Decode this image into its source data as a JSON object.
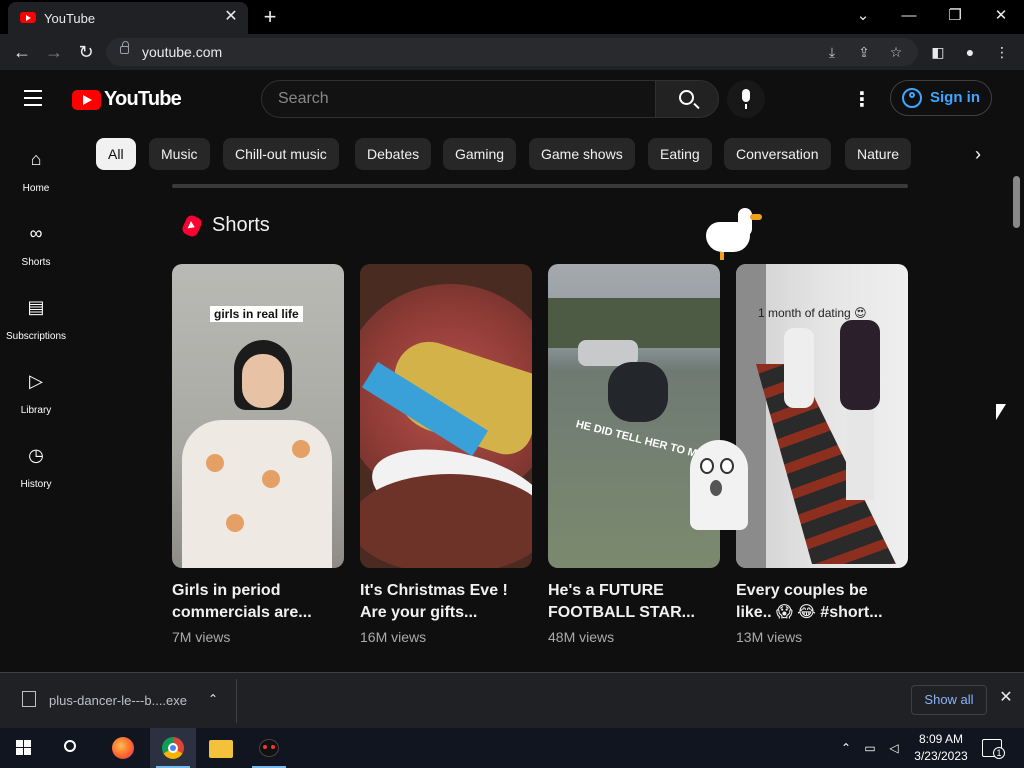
{
  "browser": {
    "tab_title": "YouTube",
    "url": "youtube.com"
  },
  "header": {
    "logo_text": "YouTube",
    "search_placeholder": "Search",
    "signin_label": "Sign in"
  },
  "sidebar": {
    "items": [
      {
        "label": "Home",
        "icon": "home-icon"
      },
      {
        "label": "Shorts",
        "icon": "shorts-icon"
      },
      {
        "label": "Subscriptions",
        "icon": "subscriptions-icon"
      },
      {
        "label": "Library",
        "icon": "library-icon"
      },
      {
        "label": "History",
        "icon": "history-icon"
      }
    ]
  },
  "chips": [
    "All",
    "Music",
    "Chill-out music",
    "Debates",
    "Gaming",
    "Game shows",
    "Eating",
    "Conversation",
    "Nature"
  ],
  "shorts": {
    "section_title": "Shorts",
    "items": [
      {
        "title_line1": "Girls in period",
        "title_line2": "commercials are...",
        "views": "7M views",
        "overlay": "girls in real life"
      },
      {
        "title_line1": "It's Christmas Eve !",
        "title_line2": "Are your gifts...",
        "views": "16M views",
        "overlay": ""
      },
      {
        "title_line1": "He's a FUTURE",
        "title_line2": "FOOTBALL STAR...",
        "views": "48M views",
        "overlay": "HE DID TELL HER TO MOVE 😂😂"
      },
      {
        "title_line1": "Every couples be",
        "title_line2": "like.. 😱 😂 #short...",
        "views": "13M views",
        "overlay": "1 month of dating 😍"
      }
    ]
  },
  "downloads": {
    "filename": "plus-dancer-le---b....exe",
    "show_all_label": "Show all"
  },
  "taskbar": {
    "time": "8:09 AM",
    "date": "3/23/2023",
    "notification_count": "1"
  },
  "colors": {
    "brand_red": "#ff0000",
    "link_blue": "#3ea6ff",
    "background": "#0f0f0f"
  }
}
